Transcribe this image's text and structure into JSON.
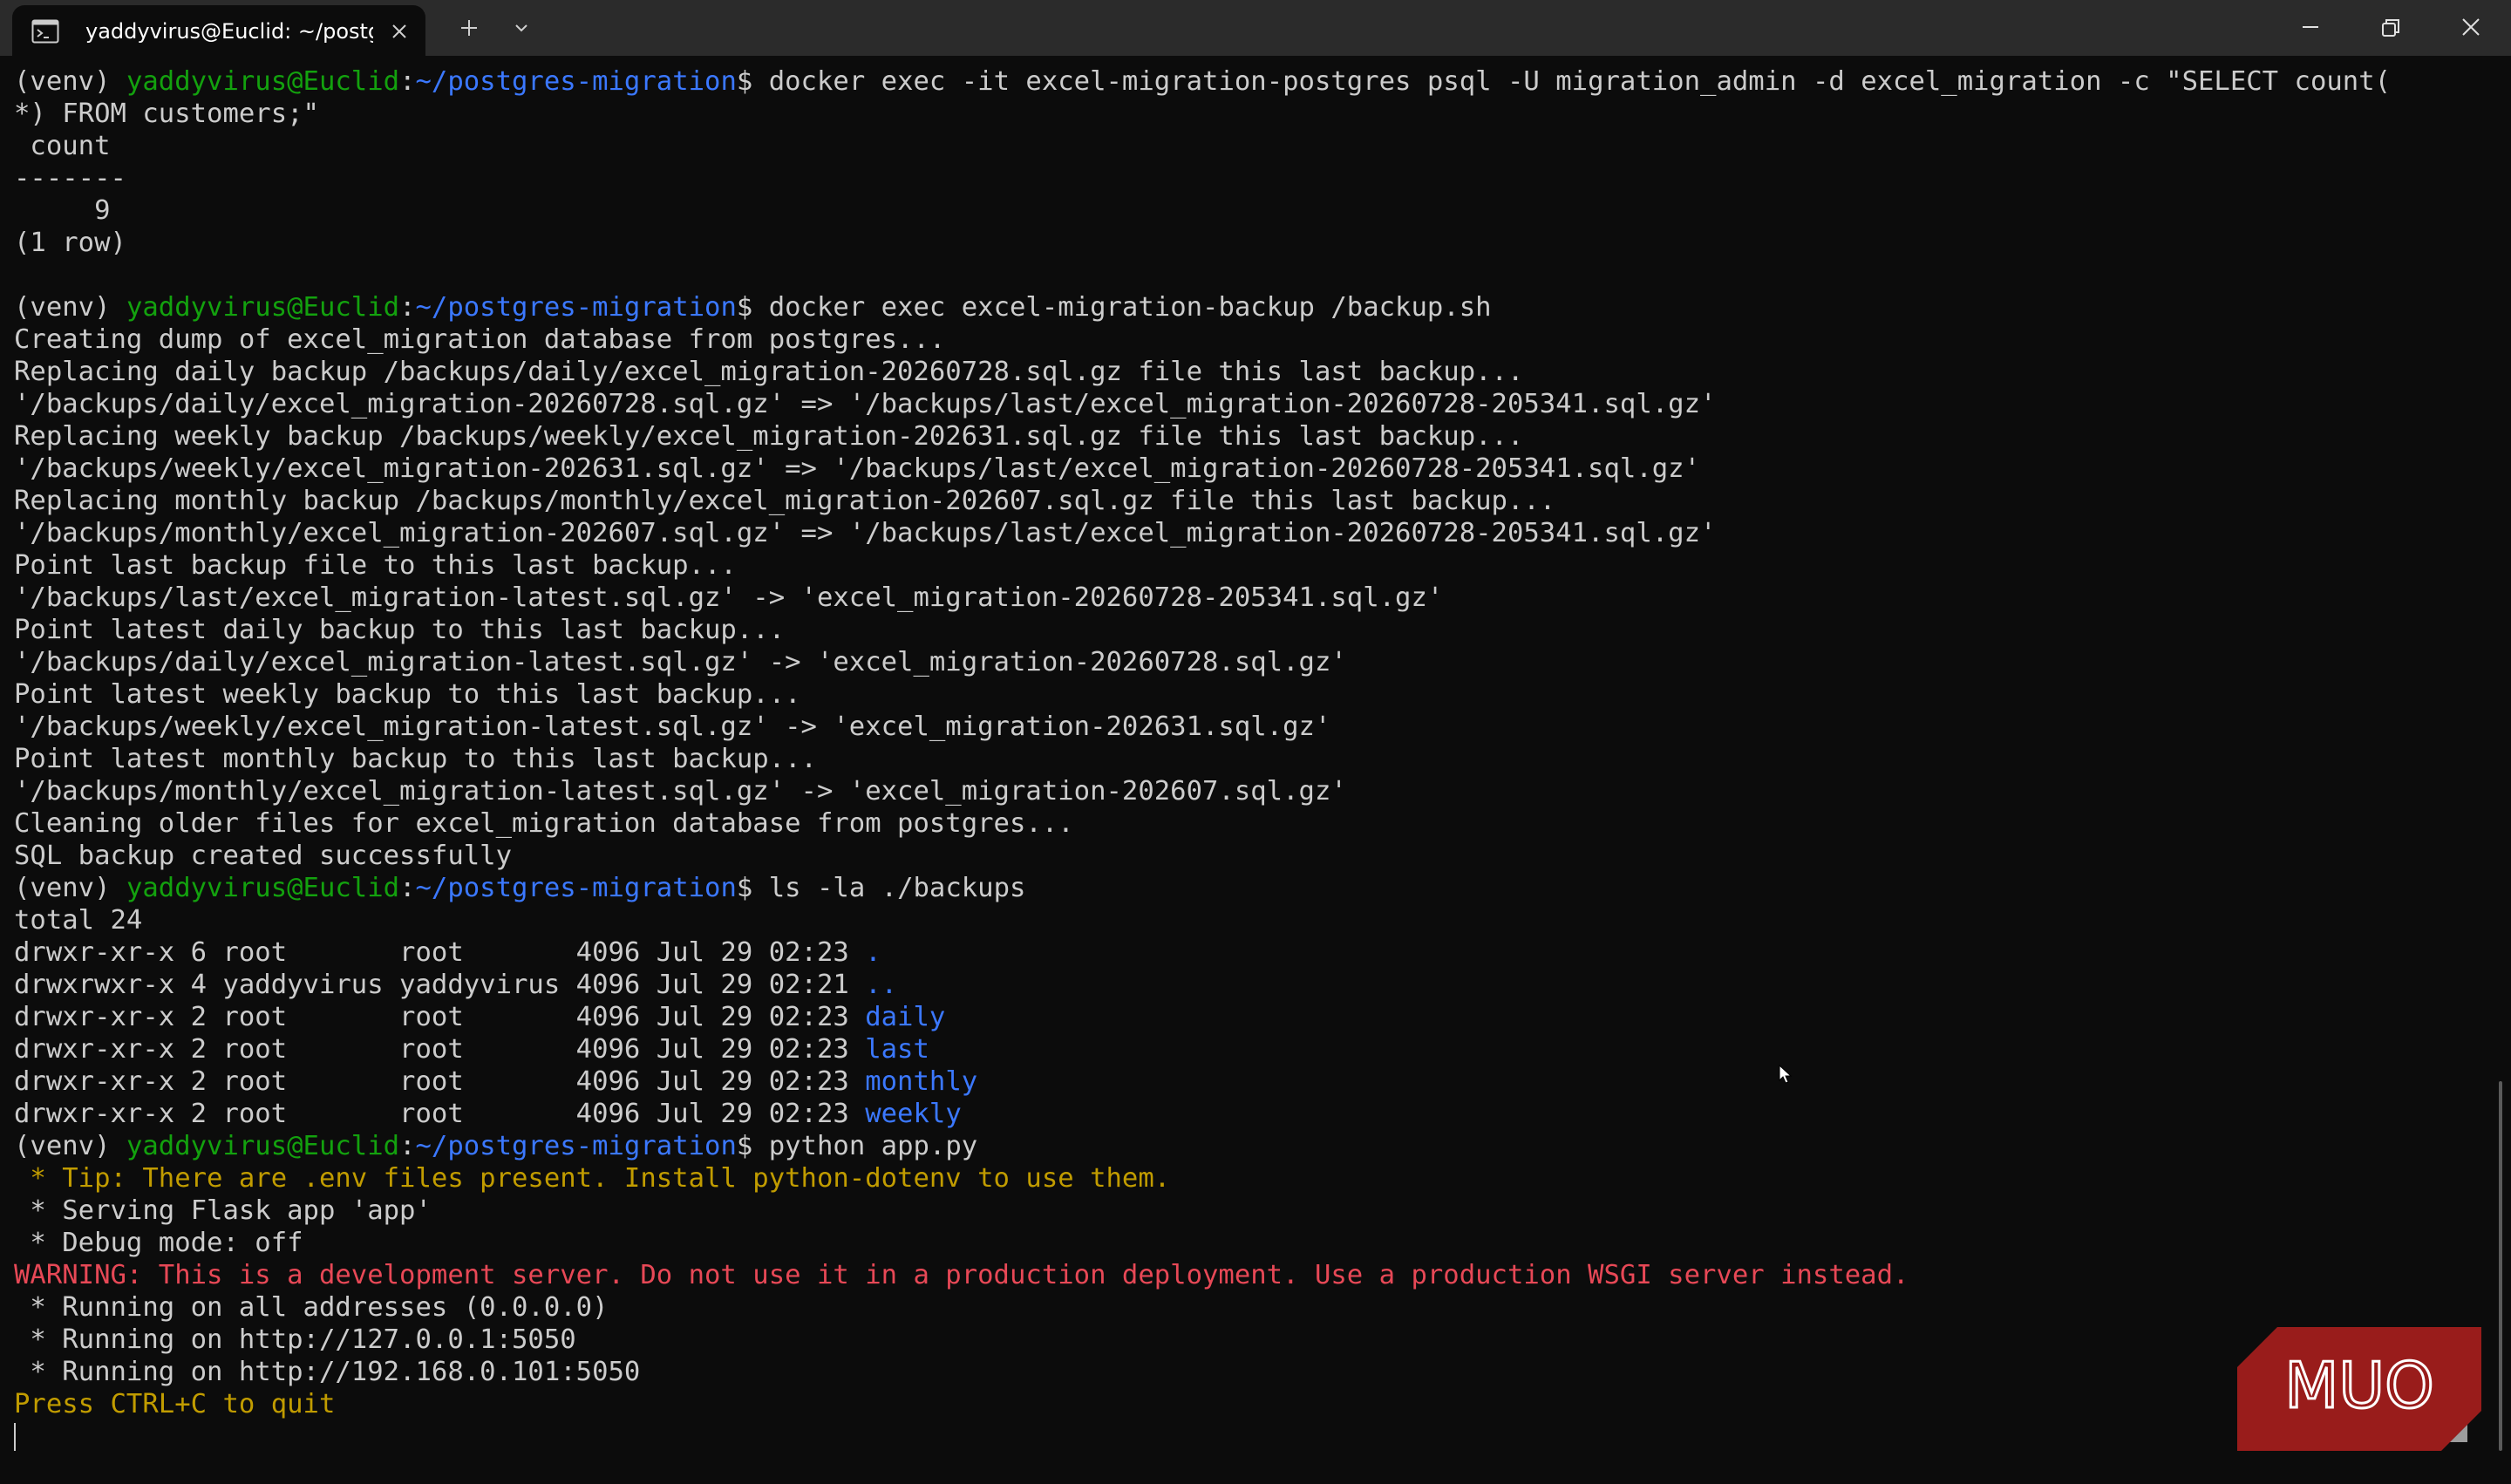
{
  "window": {
    "tab_title": "yaddyvirus@Euclid: ~/postgres-migration",
    "tab_icon": "terminal-icon",
    "new_tab_icon": "plus-icon",
    "dropdown_icon": "chevron-down-icon",
    "controls": [
      "minimize-icon",
      "restore-icon",
      "close-icon"
    ]
  },
  "colors": {
    "background": "#0c0c0c",
    "titlebar": "#2b2b2b",
    "text": "#cccccc",
    "prompt_user": "#13a10e",
    "prompt_path": "#3b78ff",
    "directory": "#3b78ff",
    "warning": "#e74856",
    "tip": "#c19c00"
  },
  "prompt": {
    "venv": "(venv) ",
    "user_host": "yaddyvirus@Euclid",
    "colon": ":",
    "path": "~/postgres-migration",
    "dollar": "$ "
  },
  "commands": {
    "psql_cmd": "docker exec -it excel-migration-postgres psql -U migration_admin -d excel_migration -c \"SELECT count(",
    "psql_cmd_cont": "*) FROM customers;\"",
    "backup_cmd": "docker exec excel-migration-backup /backup.sh",
    "ls_cmd": "ls -la ./backups",
    "python_cmd": "python app.py"
  },
  "psql_output": {
    "header": " count",
    "separator": "-------",
    "value": "     9",
    "rows": "(1 row)"
  },
  "backup_output": [
    "Creating dump of excel_migration database from postgres...",
    "Replacing daily backup /backups/daily/excel_migration-20260728.sql.gz file this last backup...",
    "'/backups/daily/excel_migration-20260728.sql.gz' => '/backups/last/excel_migration-20260728-205341.sql.gz'",
    "Replacing weekly backup /backups/weekly/excel_migration-202631.sql.gz file this last backup...",
    "'/backups/weekly/excel_migration-202631.sql.gz' => '/backups/last/excel_migration-20260728-205341.sql.gz'",
    "Replacing monthly backup /backups/monthly/excel_migration-202607.sql.gz file this last backup...",
    "'/backups/monthly/excel_migration-202607.sql.gz' => '/backups/last/excel_migration-20260728-205341.sql.gz'",
    "Point last backup file to this last backup...",
    "'/backups/last/excel_migration-latest.sql.gz' -> 'excel_migration-20260728-205341.sql.gz'",
    "Point latest daily backup to this last backup...",
    "'/backups/daily/excel_migration-latest.sql.gz' -> 'excel_migration-20260728.sql.gz'",
    "Point latest weekly backup to this last backup...",
    "'/backups/weekly/excel_migration-latest.sql.gz' -> 'excel_migration-202631.sql.gz'",
    "Point latest monthly backup to this last backup...",
    "'/backups/monthly/excel_migration-latest.sql.gz' -> 'excel_migration-202607.sql.gz'",
    "Cleaning older files for excel_migration database from postgres...",
    "SQL backup created successfully"
  ],
  "ls_output": {
    "total": "total 24",
    "entries": [
      {
        "info": "drwxr-xr-x 6 root       root       4096 Jul 29 02:23 ",
        "name": "."
      },
      {
        "info": "drwxrwxr-x 4 yaddyvirus yaddyvirus 4096 Jul 29 02:21 ",
        "name": ".."
      },
      {
        "info": "drwxr-xr-x 2 root       root       4096 Jul 29 02:23 ",
        "name": "daily"
      },
      {
        "info": "drwxr-xr-x 2 root       root       4096 Jul 29 02:23 ",
        "name": "last"
      },
      {
        "info": "drwxr-xr-x 2 root       root       4096 Jul 29 02:23 ",
        "name": "monthly"
      },
      {
        "info": "drwxr-xr-x 2 root       root       4096 Jul 29 02:23 ",
        "name": "weekly"
      }
    ]
  },
  "flask_output": {
    "tip": " * Tip: There are .env files present. Install python-dotenv to use them.",
    "serving": " * Serving Flask app 'app'",
    "debug": " * Debug mode: off",
    "warning": "WARNING: This is a development server. Do not use it in a production deployment. Use a production WSGI server instead.",
    "running_all": " * Running on all addresses (0.0.0.0)",
    "running_local": " * Running on http://127.0.0.1:5050",
    "running_lan": " * Running on http://192.168.0.101:5050",
    "quit": "Press CTRL+C to quit"
  },
  "watermark": {
    "text": "MUO",
    "color": "#b3201f"
  }
}
